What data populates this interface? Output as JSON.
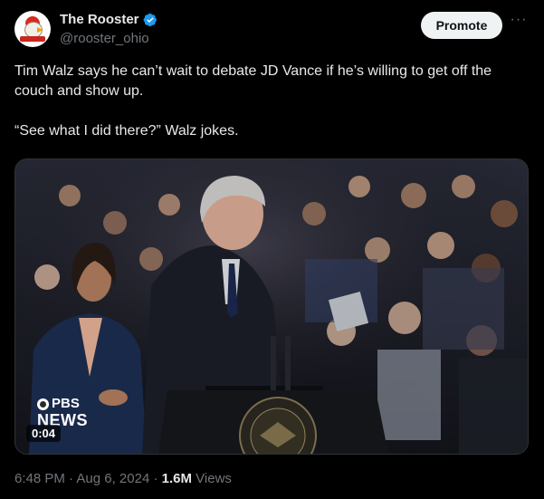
{
  "author": {
    "display_name": "The Rooster",
    "handle": "@rooster_ohio",
    "verified": true,
    "avatar_icon": "rooster-logo-icon"
  },
  "actions": {
    "promote_label": "Promote",
    "more_icon": "more-icon"
  },
  "tweet": {
    "paragraphs": [
      "Tim Walz says he can’t wait to debate JD Vance if he’s willing to get off the couch and show up.",
      "“See what I did there?” Walz jokes."
    ]
  },
  "media": {
    "type": "video",
    "watermark_top": "PBS",
    "watermark_bottom": "NEWS",
    "duration": "0:04"
  },
  "meta": {
    "time": "6:48 PM",
    "separator": "·",
    "date": "Aug 6, 2024",
    "views_count": "1.6M",
    "views_label": "Views"
  },
  "colors": {
    "background": "#000000",
    "text": "#e7e9ea",
    "secondary_text": "#71767b",
    "verified_blue": "#1d9bf0"
  }
}
